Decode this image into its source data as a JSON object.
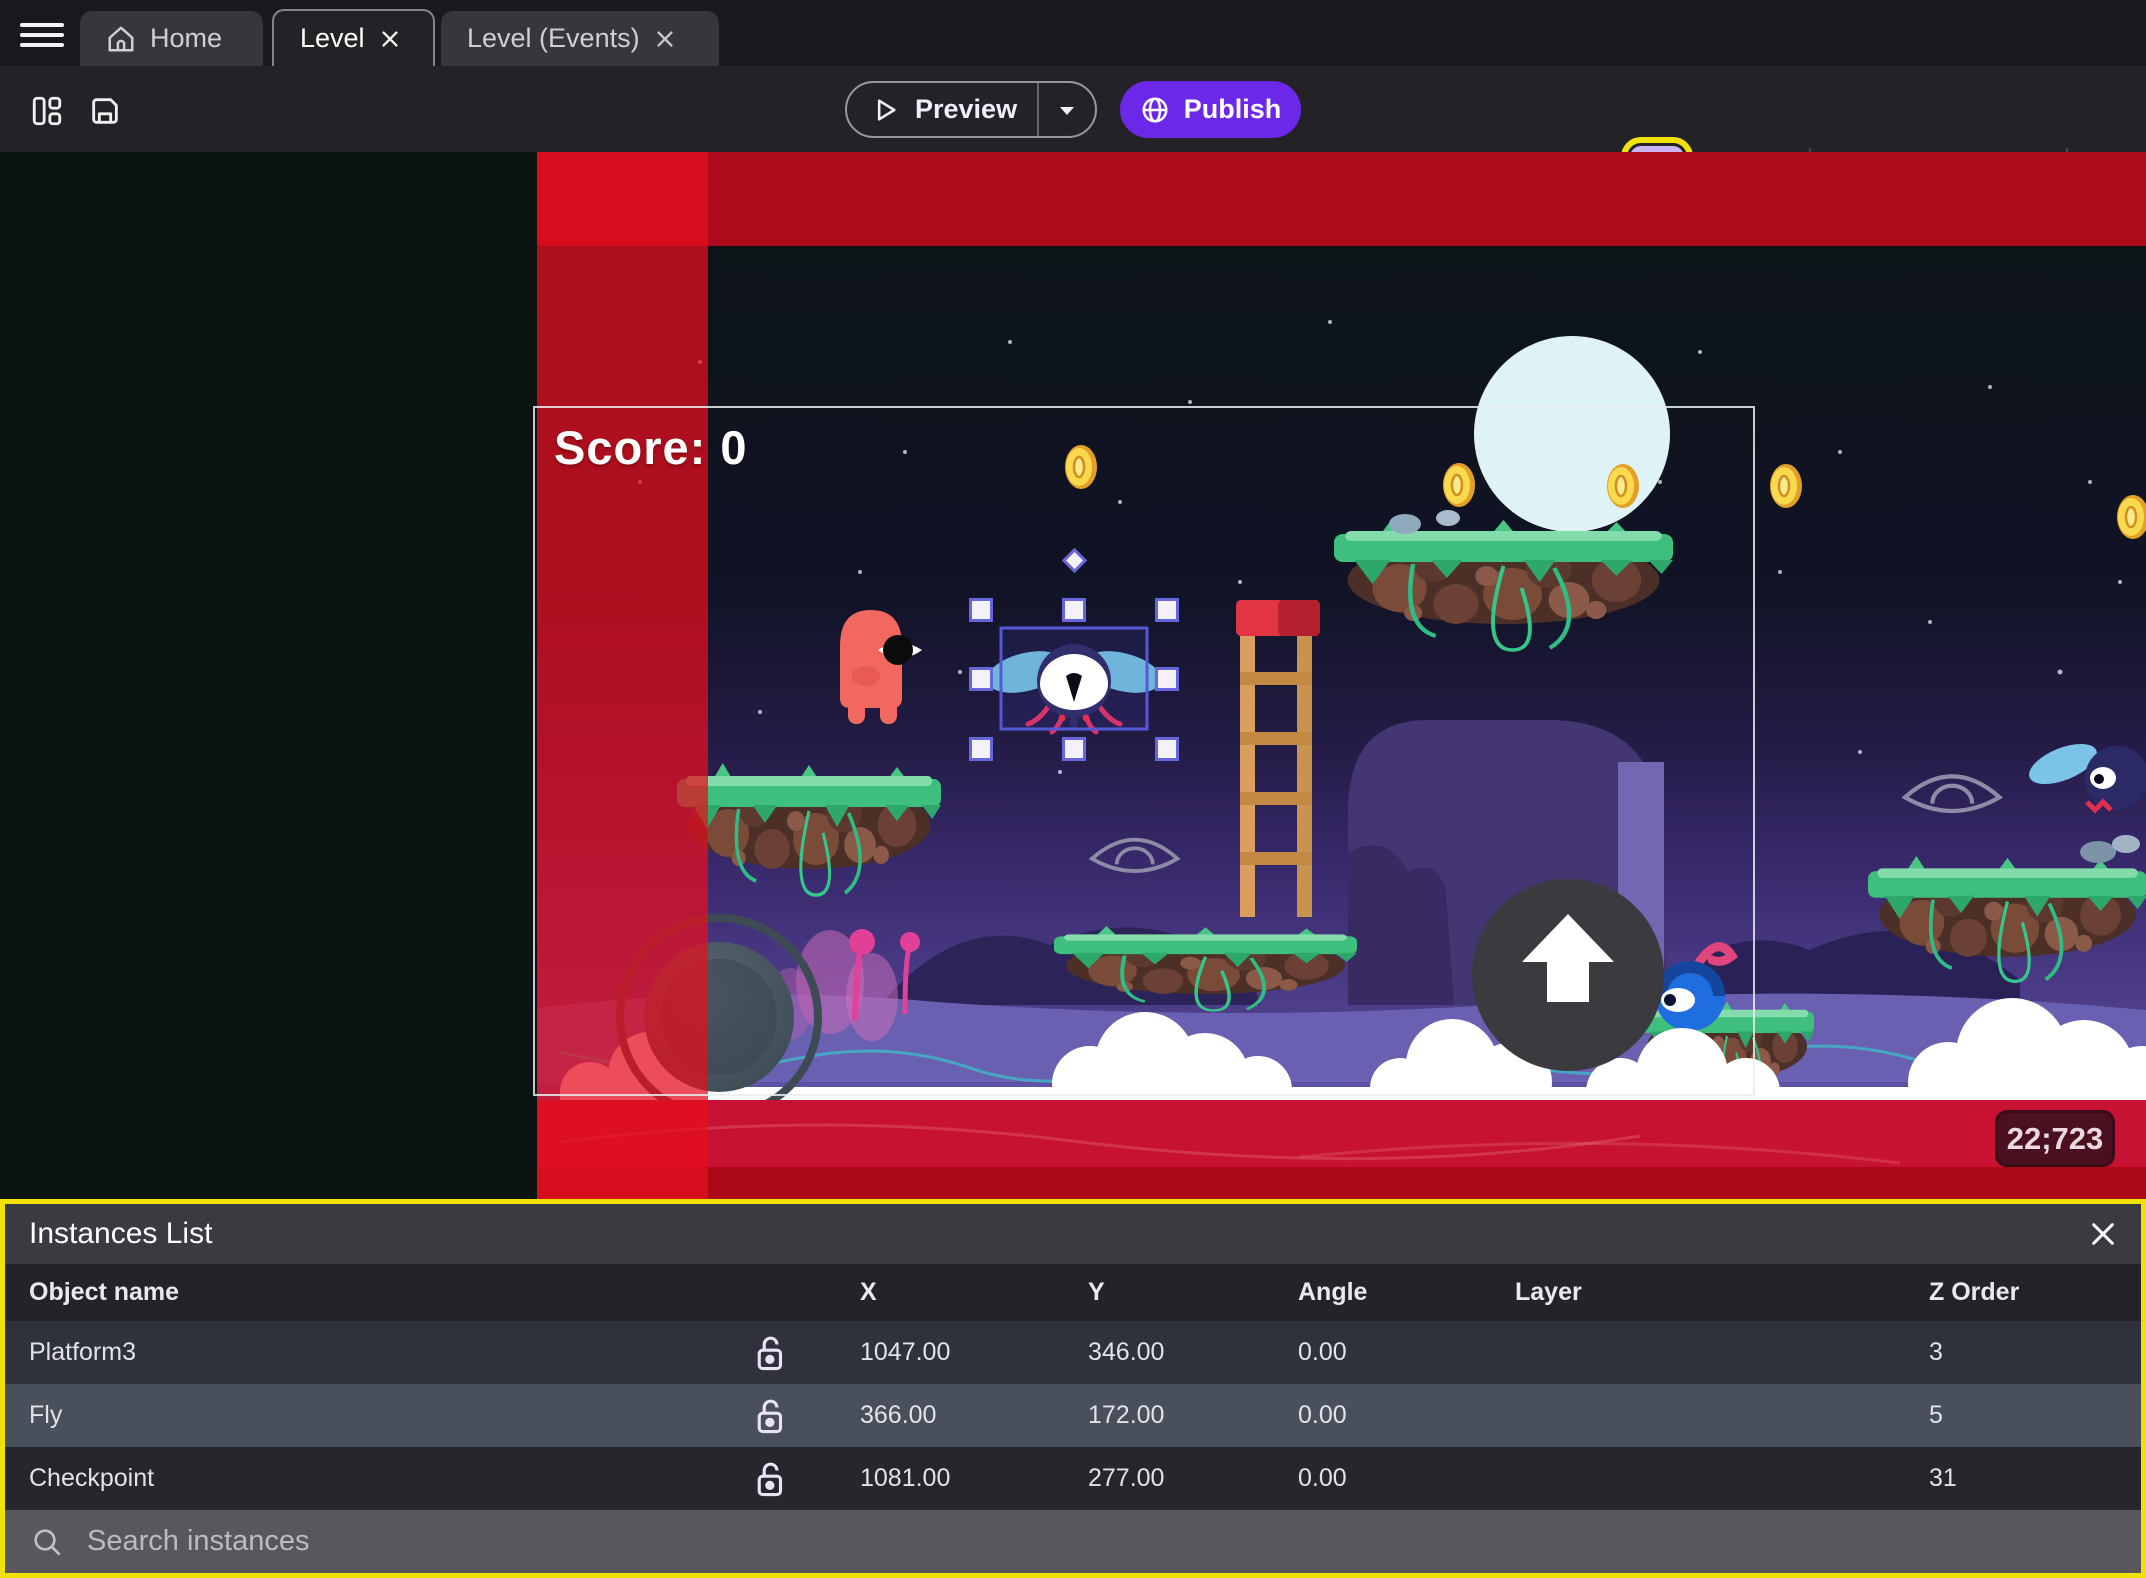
{
  "tabs": {
    "home": "Home",
    "level": "Level",
    "level_events": "Level (Events)"
  },
  "toolbar": {
    "preview_label": "Preview",
    "publish_label": "Publish"
  },
  "canvas": {
    "score_text": "Score: 0",
    "coords_badge": "22;723"
  },
  "instances_panel": {
    "title": "Instances List",
    "columns": [
      "Object name",
      "X",
      "Y",
      "Angle",
      "Layer",
      "Z Order"
    ],
    "rows": [
      {
        "name": "Platform3",
        "x": "1047.00",
        "y": "346.00",
        "angle": "0.00",
        "layer": "",
        "z": "3",
        "selected": false
      },
      {
        "name": "Fly",
        "x": "366.00",
        "y": "172.00",
        "angle": "0.00",
        "layer": "",
        "z": "5",
        "selected": true
      },
      {
        "name": "Checkpoint",
        "x": "1081.00",
        "y": "277.00",
        "angle": "0.00",
        "layer": "",
        "z": "31",
        "selected": false
      }
    ],
    "search_placeholder": "Search instances"
  },
  "icons": {
    "menu": "hamburger",
    "home": "house",
    "tab_close": "x-cross",
    "save": "floppy-disk",
    "layout": "split-panels",
    "preview": "play-triangle",
    "preview_more": "caret-down",
    "publish": "globe",
    "objects": "cube",
    "instances": "cube-stack",
    "edit": "pencil",
    "instances_list": "diamond-list",
    "layers": "layer-stack",
    "grid": "hash-grid",
    "undo": "arrow-undo",
    "redo": "arrow-redo",
    "zoom_in": "magnifier-plus",
    "delete": "trash-can",
    "properties": "note-pencil",
    "row_lock": "open-padlock",
    "search": "magnifier"
  },
  "colors": {
    "accent_purple": "#6c28e9",
    "highlight_yellow": "#f2e20a",
    "highlight_lavender": "#c9b4f5",
    "selection_purple": "#5b5bd8",
    "selected_row": "#4a4f5c",
    "red_overlay": "#ad0a1c",
    "moon": "#dff2f5",
    "grass": "#3fbf7d",
    "water": "#6a60b2"
  }
}
